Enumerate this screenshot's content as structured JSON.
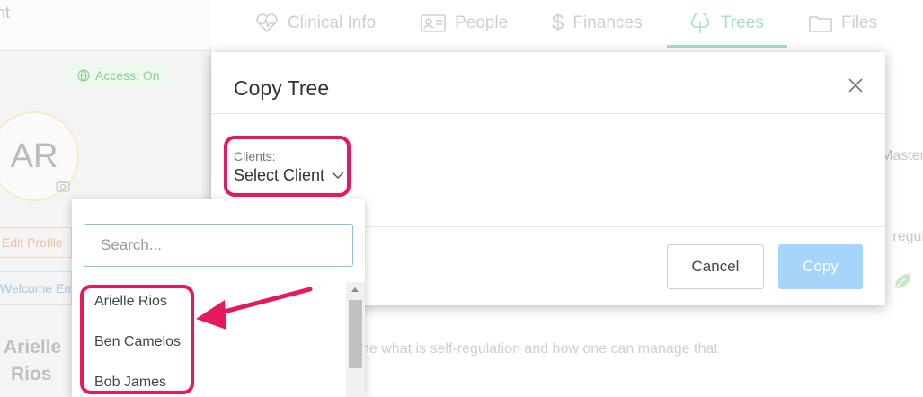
{
  "background": {
    "top_left_fragment": "nt",
    "access_badge": "Access: On",
    "avatar_initials": "AR",
    "edit_profile": "Edit Profile",
    "welcome_email": "Welcome Em",
    "name_first": "Arielle",
    "name_last": "Rios",
    "text_master": "Master",
    "text_regul": "regul",
    "description": "ne what is self-regulation and how one can manage that"
  },
  "tabs": [
    {
      "label": "Clinical Info",
      "icon": "heart-pulse-icon"
    },
    {
      "label": "People",
      "icon": "id-card-icon"
    },
    {
      "label": "Finances",
      "icon": "dollar-icon"
    },
    {
      "label": "Trees",
      "icon": "tree-icon",
      "active": true
    },
    {
      "label": "Files",
      "icon": "folder-icon"
    }
  ],
  "modal": {
    "title": "Copy Tree",
    "clients_label": "Clients:",
    "select_value": "Select Client",
    "cancel_label": "Cancel",
    "copy_label": "Copy"
  },
  "dropdown": {
    "search_placeholder": "Search...",
    "options": [
      "Arielle Rios",
      "Ben Camelos",
      "Bob James"
    ]
  },
  "colors": {
    "accent_teal": "#a8ddd0",
    "copy_button": "#a6d4fa",
    "annotation": "#e5195e"
  }
}
